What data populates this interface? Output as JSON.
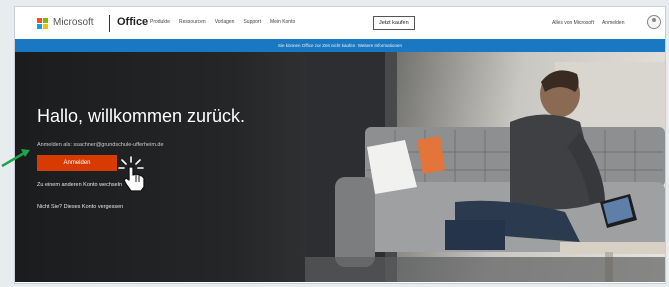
{
  "header": {
    "brand": "Microsoft",
    "product": "Office",
    "nav": [
      "Produkte",
      "Ressourcen",
      "Vorlagen",
      "Support",
      "Mein Konto"
    ],
    "buy_label": "Jetzt kaufen",
    "more_microsoft": "Alles von Microsoft",
    "sign_in": "Anmelden"
  },
  "banner": {
    "text": "Sie können Office zur Zeit nicht kaufen. Weitere Informationen"
  },
  "hero": {
    "title": "Hallo, willkommen zurück.",
    "signed_in_as": "Anmelden als: ssachner@grundschule-ufferheim.de",
    "signin_button": "Anmelden",
    "other_account": "Zu einem anderen Konto wechseln",
    "no_account": "Nicht Sie? Dieses Konto vergessen"
  },
  "colors": {
    "accent": "#d83b01",
    "banner": "#1a78c2",
    "hero_bg": "#1b1c1e",
    "pointer": "#1aa64a"
  },
  "icons": {
    "logo": "microsoft-logo-icon",
    "cursor": "hand-cursor-icon",
    "arrow": "green-pointer-arrow-icon",
    "account": "account-icon"
  }
}
